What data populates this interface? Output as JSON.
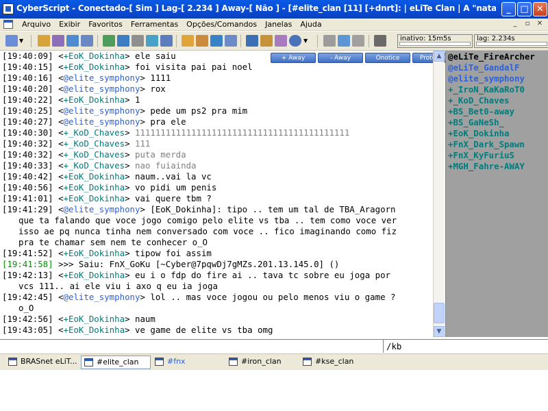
{
  "window": {
    "title": "CyberScript - Conectado-[ Sim ] Lag-[ 2.234 ] Away-[ Não ] - [#elite_clan [11] [+dnrt]:  | eLiTe Clan | A \"nata\" …",
    "minimize": "_",
    "maximize": "□",
    "close": "✕"
  },
  "menubar": {
    "items": [
      "Arquivo",
      "Exibir",
      "Favoritos",
      "Ferramentas",
      "Opções/Comandos",
      "Janelas",
      "Ajuda"
    ],
    "mdi_min": "_",
    "mdi_restore": "▫",
    "mdi_close": "✕"
  },
  "status": {
    "inativo_label": "inativo: 15m5s",
    "lag_label": "lag: 2.234s"
  },
  "actions": [
    "+ Away",
    "- Away",
    "Onotice",
    "Proteções"
  ],
  "chat_lines": [
    {
      "ts": "[19:40:09]",
      "nick": "+EoK_Dokinha",
      "nick_type": "voice",
      "msg": "ele saiu",
      "gray": false
    },
    {
      "ts": "[19:40:15]",
      "nick": "+EoK_Dokinha",
      "nick_type": "voice",
      "msg": "foi visita pai pai noel",
      "gray": false
    },
    {
      "ts": "[19:40:16]",
      "nick": "@elite_symphony",
      "nick_type": "op",
      "msg": "1111",
      "gray": false
    },
    {
      "ts": "[19:40:20]",
      "nick": "@elite_symphony",
      "nick_type": "op",
      "msg": "rox",
      "gray": false
    },
    {
      "ts": "[19:40:22]",
      "nick": "+EoK_Dokinha",
      "nick_type": "voice",
      "msg": "1",
      "gray": false
    },
    {
      "ts": "[19:40:25]",
      "nick": "@elite_symphony",
      "nick_type": "op",
      "msg": "pede um ps2 pra mim",
      "gray": false
    },
    {
      "ts": "[19:40:27]",
      "nick": "@elite_symphony",
      "nick_type": "op",
      "msg": "pra ele",
      "gray": false
    },
    {
      "ts": "[19:40:30]",
      "nick": "+_KoD_Chaves",
      "nick_type": "voice",
      "msg": "111111111111111111111111111111111111111111",
      "gray": true
    },
    {
      "ts": "[19:40:32]",
      "nick": "+_KoD_Chaves",
      "nick_type": "voice",
      "msg": "111",
      "gray": true
    },
    {
      "ts": "[19:40:32]",
      "nick": "+_KoD_Chaves",
      "nick_type": "voice",
      "msg": "puta merda",
      "gray": true
    },
    {
      "ts": "[19:40:33]",
      "nick": "+_KoD_Chaves",
      "nick_type": "voice",
      "msg": "nao fuiainda",
      "gray": true
    },
    {
      "ts": "[19:40:42]",
      "nick": "+EoK_Dokinha",
      "nick_type": "voice",
      "msg": "naum..vai la vc",
      "gray": false
    },
    {
      "ts": "[19:40:56]",
      "nick": "+EoK_Dokinha",
      "nick_type": "voice",
      "msg": "vo pidi um penis",
      "gray": false
    },
    {
      "ts": "[19:41:01]",
      "nick": "+EoK_Dokinha",
      "nick_type": "voice",
      "msg": "vai quere tbm ?",
      "gray": false
    },
    {
      "ts": "[19:41:29]",
      "nick": "@elite_symphony",
      "nick_type": "op",
      "msg": "[EoK_Dokinha]: tipo .. tem um tal de TBA_Aragorn",
      "gray": false
    },
    {
      "ts": "",
      "nick": "",
      "nick_type": "cont",
      "msg": "que ta falando que voce jogo comigo pelo elite vs tba .. tem como voce ver",
      "gray": false
    },
    {
      "ts": "",
      "nick": "",
      "nick_type": "cont",
      "msg": "isso ae pq nunca tinha nem conversado com voce .. fico imaginando como fiz",
      "gray": false
    },
    {
      "ts": "",
      "nick": "",
      "nick_type": "cont",
      "msg": "pra te chamar sem nem te conhecer o_O",
      "gray": false
    },
    {
      "ts": "[19:41:52]",
      "nick": "+EoK_Dokinha",
      "nick_type": "voice",
      "msg": "tipow foi assim",
      "gray": false
    },
    {
      "ts": "[19:41:58]",
      "nick": "",
      "nick_type": "quit",
      "msg": ">>> Saiu: FnX_GoKu [~Cyber@7pqwDj7gMZs.201.13.145.0] ()",
      "gray": false
    },
    {
      "ts": "[19:42:13]",
      "nick": "+EoK_Dokinha",
      "nick_type": "voice",
      "msg": "eu i o fdp do fire ai .. tava tc sobre eu joga por",
      "gray": false
    },
    {
      "ts": "",
      "nick": "",
      "nick_type": "cont",
      "msg": "vcs 111.. ai ele viu i axo q eu ia joga",
      "gray": false
    },
    {
      "ts": "[19:42:45]",
      "nick": "@elite_symphony",
      "nick_type": "op",
      "msg": "lol .. mas voce jogou ou pelo menos viu o game ?",
      "gray": false
    },
    {
      "ts": "",
      "nick": "",
      "nick_type": "cont",
      "msg": "o_O",
      "gray": false
    },
    {
      "ts": "[19:42:56]",
      "nick": "+EoK_Dokinha",
      "nick_type": "voice",
      "msg": "naum",
      "gray": false
    },
    {
      "ts": "[19:43:05]",
      "nick": "+EoK_Dokinha",
      "nick_type": "voice",
      "msg": "ve game de elite vs tba omg",
      "gray": false
    }
  ],
  "nicklist": [
    {
      "name": "@eLiTe_FireArcher",
      "type": "owner"
    },
    {
      "name": "@eLiTe_GandalF",
      "type": "op"
    },
    {
      "name": "@elite_symphony",
      "type": "op"
    },
    {
      "name": "+_IroN_KaKaRoT0",
      "type": "voice"
    },
    {
      "name": "+_KoD_Chaves",
      "type": "voice"
    },
    {
      "name": "+BS_Bet0-away",
      "type": "voice"
    },
    {
      "name": "+BS_GaNeSh_",
      "type": "voice"
    },
    {
      "name": "+EoK_Dokinha",
      "type": "voice"
    },
    {
      "name": "+FnX_Dark_Spawn",
      "type": "voice"
    },
    {
      "name": "+FnX_KyFuriuS",
      "type": "voice"
    },
    {
      "name": "+MGH_Fahre-AWAY",
      "type": "voice"
    }
  ],
  "input": {
    "value": "",
    "aux_text": "/kb"
  },
  "switchbar": {
    "tabs": [
      {
        "label": "BRASnet eLiT...",
        "active": false,
        "blue": false
      },
      {
        "label": "#elite_clan",
        "active": true,
        "blue": false
      },
      {
        "label": "#fnx",
        "active": false,
        "blue": true
      },
      {
        "label": "#iron_clan",
        "active": false,
        "blue": false
      },
      {
        "label": "#kse_clan",
        "active": false,
        "blue": false
      }
    ]
  }
}
